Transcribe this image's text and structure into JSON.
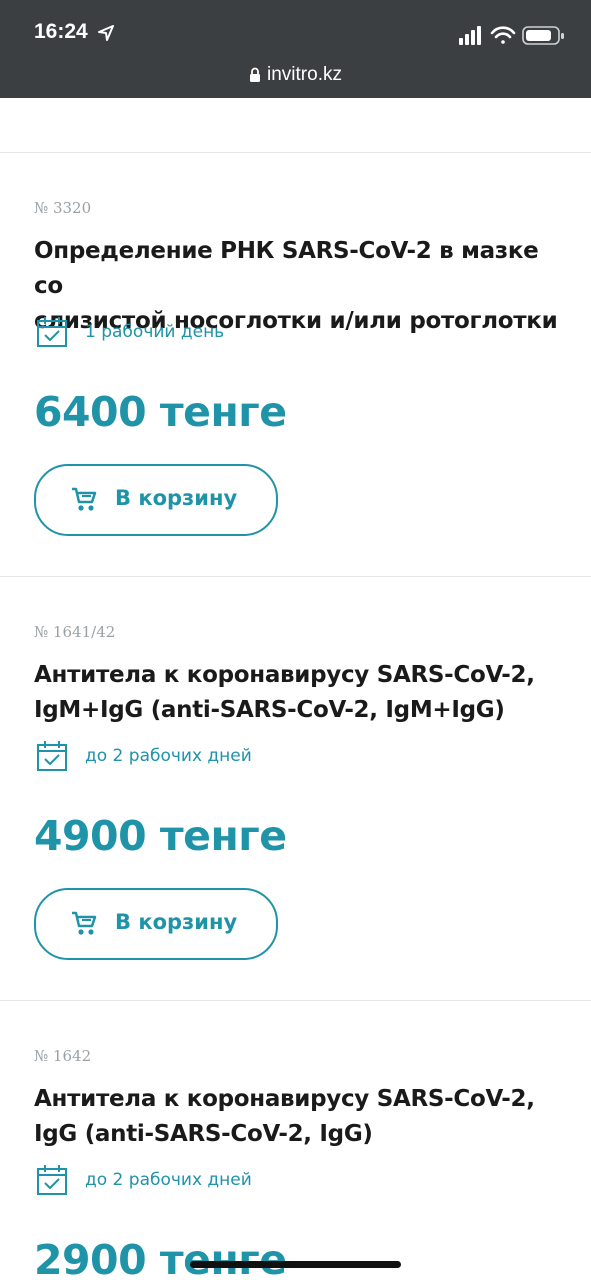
{
  "status_bar": {
    "time": "16:24",
    "url": "invitro.kz"
  },
  "products": [
    {
      "number": "№ 3320",
      "title_line1": "Определение РНК SARS-CoV-2 в мазке со",
      "title_line2": "слизистой носоглотки и/или ротоглотки",
      "term": "1 рабочий день",
      "price": "6400 тенге",
      "button": "В корзину"
    },
    {
      "number": "№ 1641/42",
      "title_line1": "Антитела к коронавирусу SARS-CoV-2,",
      "title_line2": "IgM+IgG (anti-SARS-CoV-2, IgM+IgG)",
      "term": "до 2 рабочих дней",
      "price": "4900 тенге",
      "button": "В корзину"
    },
    {
      "number": "№ 1642",
      "title_line1": "Антитела к коронавирусу SARS-CoV-2,",
      "title_line2": "IgG (anti-SARS-CoV-2, IgG)",
      "term": "до 2 рабочих дней",
      "price": "2900 тенге"
    }
  ],
  "colors": {
    "accent": "#1f93a8",
    "status_bar_bg": "#3b3f42",
    "title": "#1a1a1a",
    "muted": "#9aa1a6"
  }
}
